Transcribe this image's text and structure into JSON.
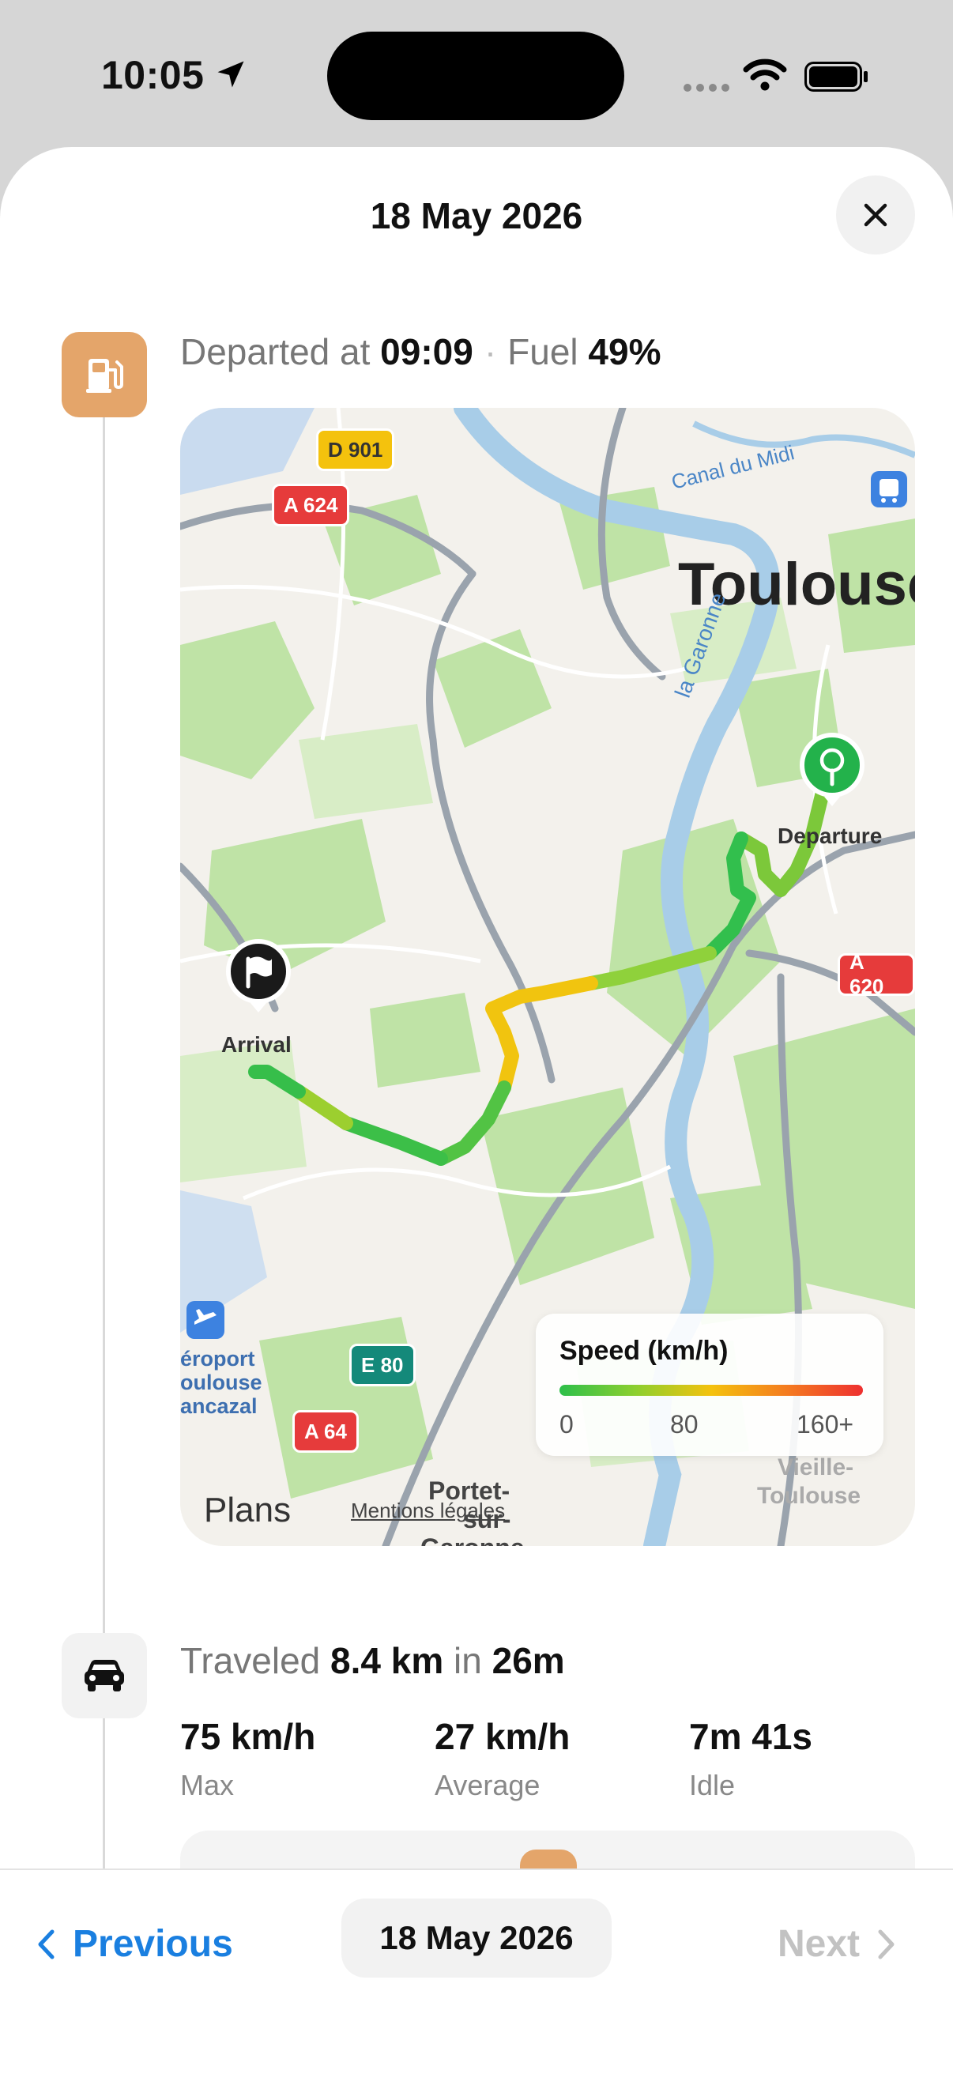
{
  "status": {
    "time": "10:05"
  },
  "sheet": {
    "title": "18 May 2026"
  },
  "departure": {
    "prefix": "Departed at",
    "time": "09:09",
    "fuel_label": "Fuel",
    "fuel_value": "49%"
  },
  "map": {
    "city": "Toulouse",
    "canal": "Canal du Midi",
    "river": "la Garonne",
    "departure_label": "Departure",
    "arrival_label": "Arrival",
    "roads": [
      "D 901",
      "A 624",
      "A 620",
      "E 80",
      "A 64"
    ],
    "airport": [
      "éroport",
      "oulouse",
      "ancazal"
    ],
    "places": [
      "Portet-",
      "sur-",
      "Garonne",
      "Vieille-",
      "Toulouse"
    ],
    "attribution": "Plans",
    "mentions": "Mentions légales",
    "legend": {
      "title": "Speed (km/h)",
      "ticks": [
        "0",
        "80",
        "160+"
      ]
    },
    "colors": {
      "route_slow": "#2dbf4a",
      "route_mid": "#f4c20d",
      "departure_pin": "#23b24b",
      "arrival_pin": "#1a1a1a"
    }
  },
  "trip": {
    "prefix": "Traveled",
    "distance": "8.4 km",
    "joiner": "in",
    "duration": "26m",
    "stats": [
      {
        "value": "75 km/h",
        "label": "Max"
      },
      {
        "value": "27 km/h",
        "label": "Average"
      },
      {
        "value": "7m 41s",
        "label": "Idle"
      }
    ]
  },
  "nav": {
    "previous": "Previous",
    "current": "18 May 2026",
    "next": "Next"
  }
}
